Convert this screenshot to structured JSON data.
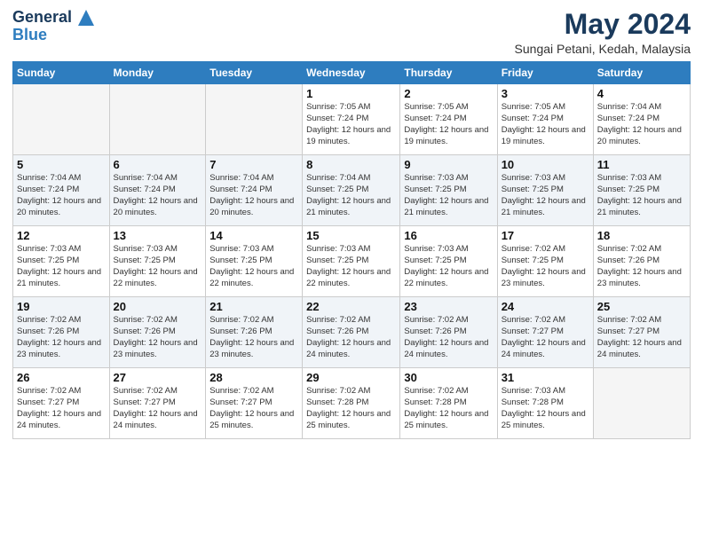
{
  "header": {
    "logo_line1": "General",
    "logo_line2": "Blue",
    "title": "May 2024",
    "subtitle": "Sungai Petani, Kedah, Malaysia"
  },
  "weekdays": [
    "Sunday",
    "Monday",
    "Tuesday",
    "Wednesday",
    "Thursday",
    "Friday",
    "Saturday"
  ],
  "weeks": [
    [
      {
        "day": "",
        "empty": true
      },
      {
        "day": "",
        "empty": true
      },
      {
        "day": "",
        "empty": true
      },
      {
        "day": "1",
        "sunrise": "7:05 AM",
        "sunset": "7:24 PM",
        "daylight": "12 hours and 19 minutes."
      },
      {
        "day": "2",
        "sunrise": "7:05 AM",
        "sunset": "7:24 PM",
        "daylight": "12 hours and 19 minutes."
      },
      {
        "day": "3",
        "sunrise": "7:05 AM",
        "sunset": "7:24 PM",
        "daylight": "12 hours and 19 minutes."
      },
      {
        "day": "4",
        "sunrise": "7:04 AM",
        "sunset": "7:24 PM",
        "daylight": "12 hours and 20 minutes."
      }
    ],
    [
      {
        "day": "5",
        "sunrise": "7:04 AM",
        "sunset": "7:24 PM",
        "daylight": "12 hours and 20 minutes."
      },
      {
        "day": "6",
        "sunrise": "7:04 AM",
        "sunset": "7:24 PM",
        "daylight": "12 hours and 20 minutes."
      },
      {
        "day": "7",
        "sunrise": "7:04 AM",
        "sunset": "7:24 PM",
        "daylight": "12 hours and 20 minutes."
      },
      {
        "day": "8",
        "sunrise": "7:04 AM",
        "sunset": "7:25 PM",
        "daylight": "12 hours and 21 minutes."
      },
      {
        "day": "9",
        "sunrise": "7:03 AM",
        "sunset": "7:25 PM",
        "daylight": "12 hours and 21 minutes."
      },
      {
        "day": "10",
        "sunrise": "7:03 AM",
        "sunset": "7:25 PM",
        "daylight": "12 hours and 21 minutes."
      },
      {
        "day": "11",
        "sunrise": "7:03 AM",
        "sunset": "7:25 PM",
        "daylight": "12 hours and 21 minutes."
      }
    ],
    [
      {
        "day": "12",
        "sunrise": "7:03 AM",
        "sunset": "7:25 PM",
        "daylight": "12 hours and 21 minutes."
      },
      {
        "day": "13",
        "sunrise": "7:03 AM",
        "sunset": "7:25 PM",
        "daylight": "12 hours and 22 minutes."
      },
      {
        "day": "14",
        "sunrise": "7:03 AM",
        "sunset": "7:25 PM",
        "daylight": "12 hours and 22 minutes."
      },
      {
        "day": "15",
        "sunrise": "7:03 AM",
        "sunset": "7:25 PM",
        "daylight": "12 hours and 22 minutes."
      },
      {
        "day": "16",
        "sunrise": "7:03 AM",
        "sunset": "7:25 PM",
        "daylight": "12 hours and 22 minutes."
      },
      {
        "day": "17",
        "sunrise": "7:02 AM",
        "sunset": "7:25 PM",
        "daylight": "12 hours and 23 minutes."
      },
      {
        "day": "18",
        "sunrise": "7:02 AM",
        "sunset": "7:26 PM",
        "daylight": "12 hours and 23 minutes."
      }
    ],
    [
      {
        "day": "19",
        "sunrise": "7:02 AM",
        "sunset": "7:26 PM",
        "daylight": "12 hours and 23 minutes."
      },
      {
        "day": "20",
        "sunrise": "7:02 AM",
        "sunset": "7:26 PM",
        "daylight": "12 hours and 23 minutes."
      },
      {
        "day": "21",
        "sunrise": "7:02 AM",
        "sunset": "7:26 PM",
        "daylight": "12 hours and 23 minutes."
      },
      {
        "day": "22",
        "sunrise": "7:02 AM",
        "sunset": "7:26 PM",
        "daylight": "12 hours and 24 minutes."
      },
      {
        "day": "23",
        "sunrise": "7:02 AM",
        "sunset": "7:26 PM",
        "daylight": "12 hours and 24 minutes."
      },
      {
        "day": "24",
        "sunrise": "7:02 AM",
        "sunset": "7:27 PM",
        "daylight": "12 hours and 24 minutes."
      },
      {
        "day": "25",
        "sunrise": "7:02 AM",
        "sunset": "7:27 PM",
        "daylight": "12 hours and 24 minutes."
      }
    ],
    [
      {
        "day": "26",
        "sunrise": "7:02 AM",
        "sunset": "7:27 PM",
        "daylight": "12 hours and 24 minutes."
      },
      {
        "day": "27",
        "sunrise": "7:02 AM",
        "sunset": "7:27 PM",
        "daylight": "12 hours and 24 minutes."
      },
      {
        "day": "28",
        "sunrise": "7:02 AM",
        "sunset": "7:27 PM",
        "daylight": "12 hours and 25 minutes."
      },
      {
        "day": "29",
        "sunrise": "7:02 AM",
        "sunset": "7:28 PM",
        "daylight": "12 hours and 25 minutes."
      },
      {
        "day": "30",
        "sunrise": "7:02 AM",
        "sunset": "7:28 PM",
        "daylight": "12 hours and 25 minutes."
      },
      {
        "day": "31",
        "sunrise": "7:03 AM",
        "sunset": "7:28 PM",
        "daylight": "12 hours and 25 minutes."
      },
      {
        "day": "",
        "empty": true
      }
    ]
  ]
}
